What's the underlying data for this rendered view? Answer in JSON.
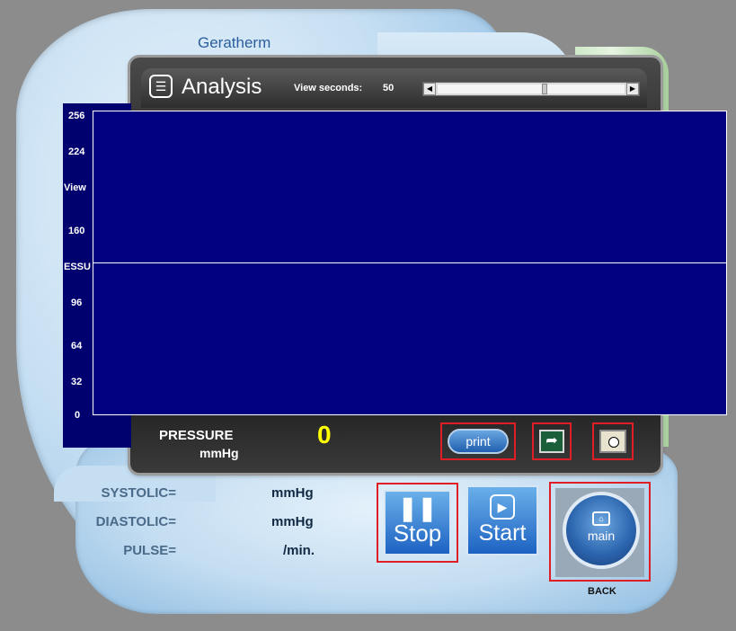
{
  "brand": "Geratherm",
  "window": {
    "title": "Analysis",
    "view_seconds_label": "View seconds:",
    "view_seconds_value": "50",
    "scroll_position": 0.56
  },
  "chart_data": {
    "type": "line",
    "ylabel": "View",
    "ylabel_partial": "ESSU",
    "y_ticks": [
      "256",
      "224",
      "160",
      "96",
      "64",
      "32",
      "0"
    ],
    "ylim": [
      0,
      256
    ],
    "series": [
      {
        "values": [
          128,
          128
        ]
      }
    ],
    "grid": false
  },
  "pressure": {
    "label": "PRESSURE",
    "unit": "mmHg",
    "value": "0"
  },
  "buttons": {
    "print": "print",
    "stop": "Stop",
    "start": "Start",
    "main": "main",
    "back": "BACK"
  },
  "vitals": [
    {
      "label": "SYSTOLIC=",
      "unit": "mmHg"
    },
    {
      "label": "DIASTOLIC=",
      "unit": "mmHg"
    },
    {
      "label": "PULSE=",
      "unit": "/min."
    }
  ],
  "icons": {
    "analysis": "document-icon",
    "redo": "redo-arrow-icon",
    "pause": "pause-icon",
    "play": "play-icon",
    "home": "home-icon"
  },
  "colors": {
    "plot_bg": "#000080",
    "pressure_value": "#ffff00",
    "highlight": "#e01e25"
  }
}
